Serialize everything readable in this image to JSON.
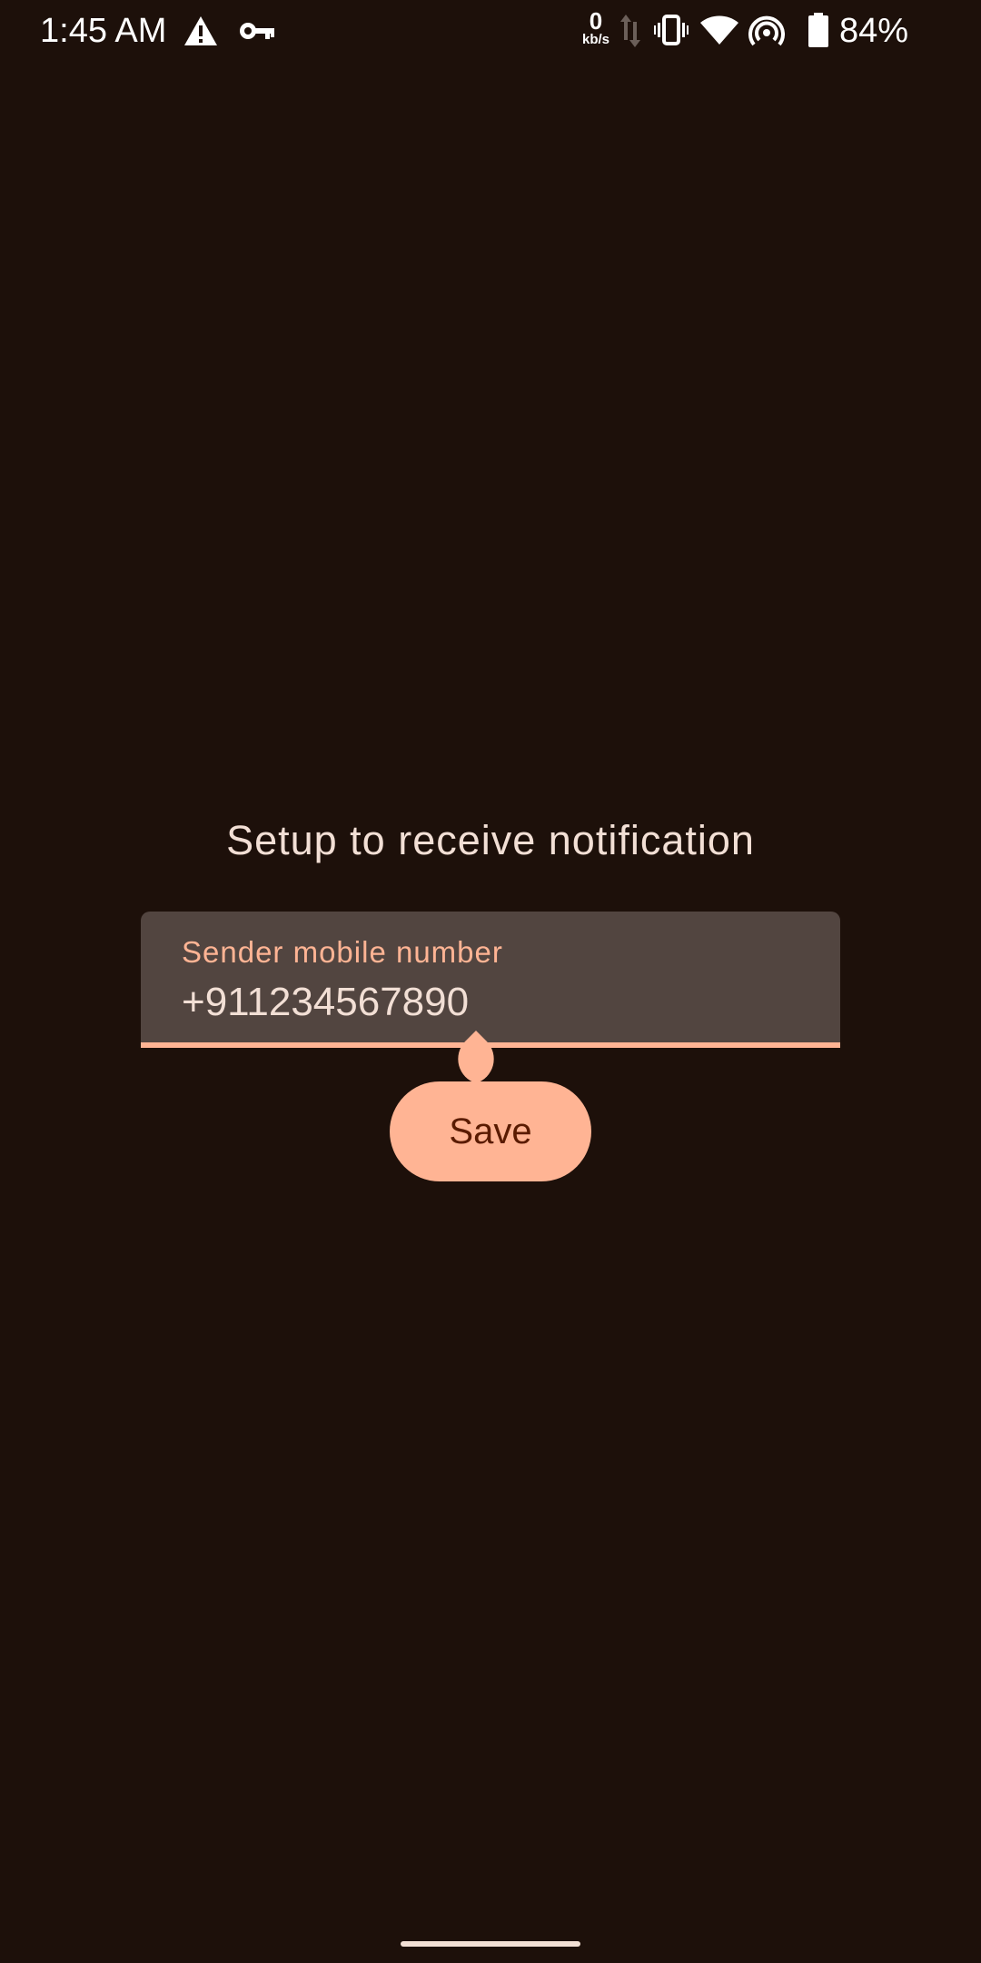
{
  "status_bar": {
    "time": "1:45 AM",
    "icons": [
      "warning-icon",
      "vpn-key-icon",
      "data-arrows-icon",
      "vibrate-icon",
      "wifi-icon",
      "hotspot-icon",
      "battery-icon"
    ],
    "network_speed_value": "0",
    "network_speed_unit": "kb/s",
    "battery_percent": "84%"
  },
  "main": {
    "title": "Setup to receive notification",
    "sender_field": {
      "label": "Sender mobile number",
      "value": "+911234567890"
    },
    "save_label": "Save"
  },
  "colors": {
    "background": "#1d100a",
    "accent": "#ffb494",
    "field_background": "#524540",
    "text_primary": "#f2dfd5",
    "button_text": "#5a1b00"
  }
}
